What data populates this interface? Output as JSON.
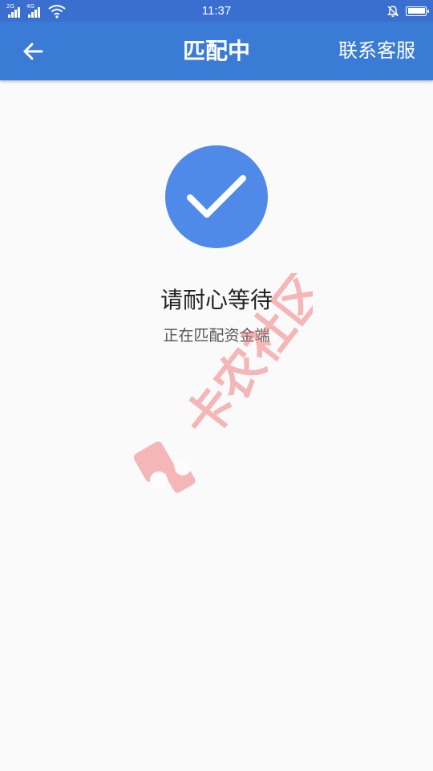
{
  "status_bar": {
    "sim1_network": "2G",
    "sim2_network": "4G",
    "time": "11:37",
    "battery_level": 1.0
  },
  "header": {
    "back_icon": "arrow-left-icon",
    "title": "匹配中",
    "contact_label": "联系客服"
  },
  "main": {
    "status_icon": "check-circle-icon",
    "title": "请耐心等待",
    "subtitle": "正在匹配资金端"
  },
  "watermark": {
    "text": "卡农社区",
    "icon": "kanong-logo-icon"
  },
  "colors": {
    "status_bar": "#3a6fd0",
    "app_bar": "#3a7bd5",
    "check_circle": "#4f8ae8",
    "background": "#fafafa",
    "watermark": "#f08080"
  }
}
